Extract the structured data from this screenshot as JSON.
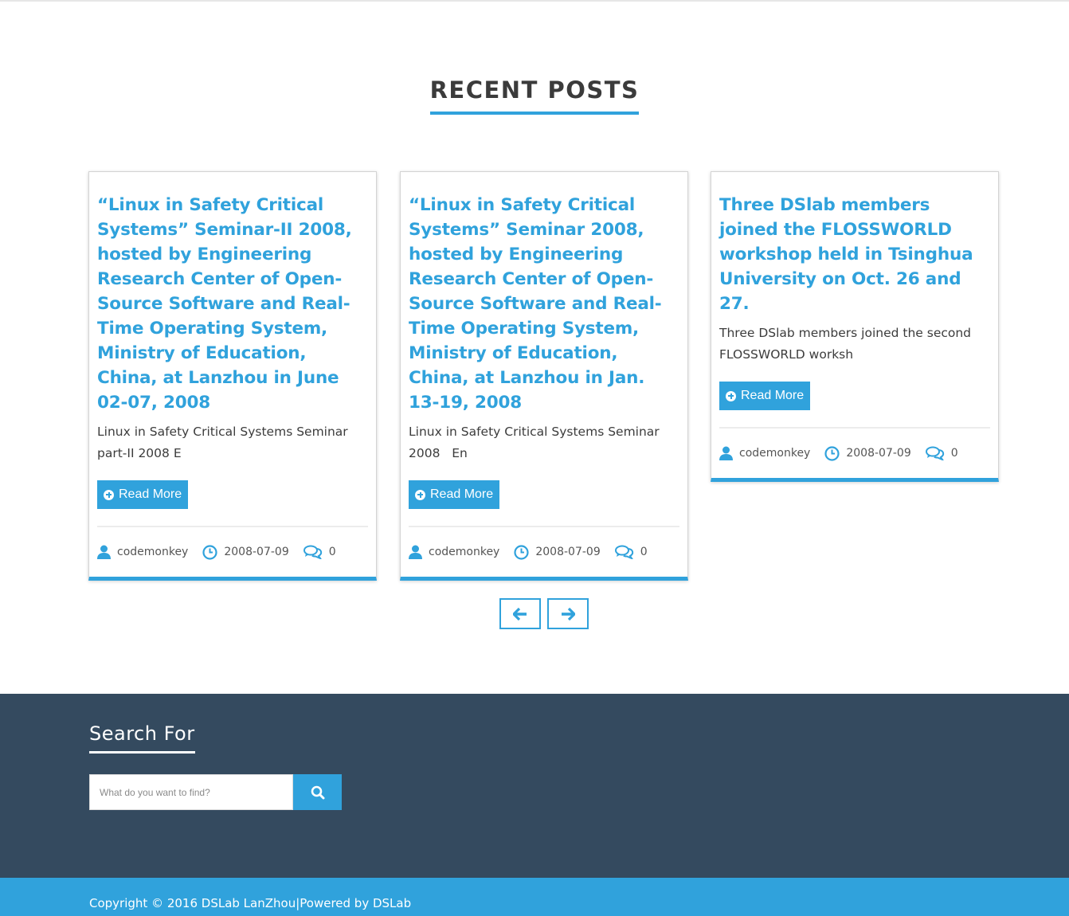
{
  "section": {
    "title": "RECENT POSTS"
  },
  "posts": [
    {
      "title": "“Linux in Safety Critical Systems” Seminar-II 2008, hosted by Engineering Research Center of Open-Source Software and Real-Time Operating System, Ministry of Education, China, at Lanzhou in June 02-07, 2008",
      "excerpt": "Linux in Safety Critical Systems Seminar part-II 2008 E",
      "read_more": "Read More",
      "author": "codemonkey",
      "date": "2008-07-09",
      "comments": "0"
    },
    {
      "title": "“Linux in Safety Critical Systems” Seminar 2008, hosted by Engineering Research Center of Open-Source Software and Real-Time Operating System, Ministry of Education, China, at Lanzhou in Jan. 13-19, 2008",
      "excerpt": "Linux in Safety Critical Systems Seminar 2008   En",
      "read_more": "Read More",
      "author": "codemonkey",
      "date": "2008-07-09",
      "comments": "0"
    },
    {
      "title": "Three DSlab members joined the FLOSSWORLD workshop held in Tsinghua University on Oct. 26 and 27.",
      "excerpt": "Three DSlab members joined the second FLOSSWORLD worksh",
      "read_more": "Read More",
      "author": "codemonkey",
      "date": "2008-07-09",
      "comments": "0"
    }
  ],
  "carousel": {
    "prev_icon": "arrow-left-icon",
    "next_icon": "arrow-right-icon"
  },
  "footer": {
    "search_title": "Search For",
    "search_placeholder": "What do you want to find?",
    "search_icon": "search-icon"
  },
  "copyright": {
    "text": "Copyright © 2016 DSLab LanZhou|Powered by DSLab"
  },
  "colors": {
    "accent": "#30a2dc",
    "footer_bg": "#344a5f",
    "text": "#3c3c3c"
  }
}
